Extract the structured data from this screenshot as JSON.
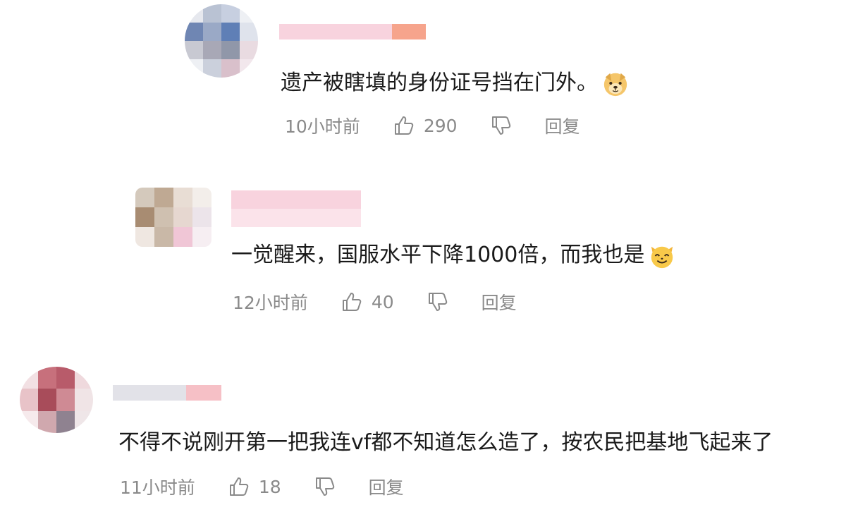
{
  "comments": [
    {
      "text": "遗产被瞎填的身份证号挡在门外。",
      "time": "10小时前",
      "likes": "290",
      "reply_label": "回复",
      "emoji": "dog-face-emoji"
    },
    {
      "text": "一觉醒来，国服水平下降1000倍，而我也是",
      "time": "12小时前",
      "likes": "40",
      "reply_label": "回复",
      "emoji": "cat-face-emoji"
    },
    {
      "text": "不得不说刚开第一把我连vf都不知道怎么造了，按农民把基地飞起来了",
      "time": "11小时前",
      "likes": "18",
      "reply_label": "回复"
    }
  ],
  "colors": {
    "text": "#1a1a1a",
    "meta": "#8a8a8a",
    "name_pink": "#f6c6d2",
    "name_orange": "#f6a48c"
  }
}
